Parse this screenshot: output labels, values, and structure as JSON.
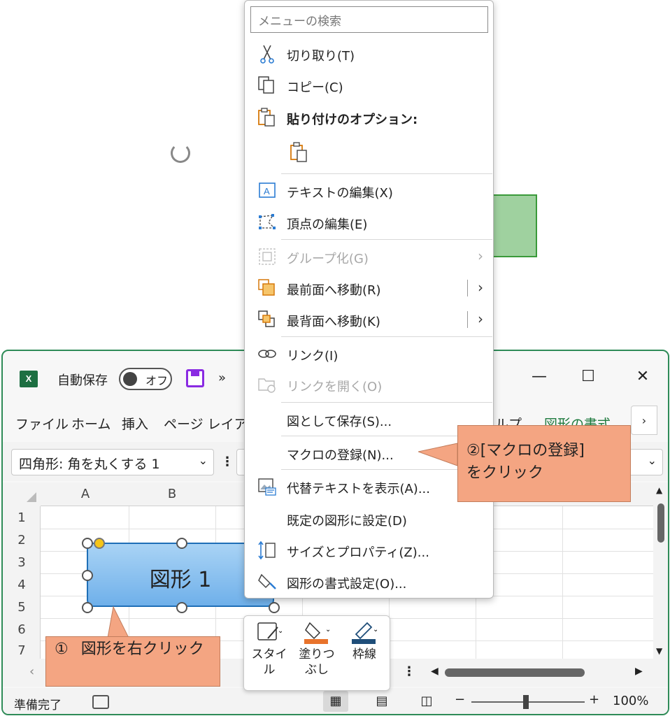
{
  "titlebar": {
    "app_icon": "X",
    "autosave_label": "自動保存",
    "toggle_label": "オフ",
    "overflow": "»",
    "minimize": "—",
    "maximize": "☐",
    "close": "✕"
  },
  "ribbon_tabs": [
    {
      "label": "ファイル"
    },
    {
      "label": "ホーム"
    },
    {
      "label": "挿入"
    },
    {
      "label": "ページ レイア"
    },
    {
      "label": "ルプ"
    },
    {
      "label": "図形の書式"
    }
  ],
  "ribbon_chevron": "›",
  "namebox": {
    "value": "四角形: 角を丸くする 1"
  },
  "columns": [
    "A",
    "B"
  ],
  "rows": [
    "1",
    "2",
    "3",
    "4",
    "5",
    "6",
    "7"
  ],
  "shape1": {
    "text": "図形 1",
    "fill": "#8cc3f0",
    "border": "#1f6fb7"
  },
  "shape2": {
    "fill": "#9fd19f",
    "border": "#3a9a3a"
  },
  "sheetbar": {
    "dots": "⋮"
  },
  "statusbar": {
    "text": "準備完了",
    "zoom_minus": "−",
    "zoom_plus": "+",
    "zoom": "100%"
  },
  "minibar": {
    "style": "スタイル",
    "fill": "塗りつぶし",
    "fill_color": "#e8732c",
    "outline": "枠線",
    "outline_color": "#1f4e79"
  },
  "context_menu": {
    "search_placeholder": "メニューの検索",
    "cut": "切り取り(T)",
    "copy": "コピー(C)",
    "paste_options": "貼り付けのオプション:",
    "edit_text": "テキストの編集(X)",
    "edit_points": "頂点の編集(E)",
    "group": "グループ化(G)",
    "bring_front": "最前面へ移動(R)",
    "send_back": "最背面へ移動(K)",
    "link": "リンク(I)",
    "open_link": "リンクを開く(O)",
    "save_as_picture": "図として保存(S)...",
    "assign_macro": "マクロの登録(N)...",
    "alt_text": "代替テキストを表示(A)...",
    "set_default": "既定の図形に設定(D)",
    "size_props": "サイズとプロパティ(Z)...",
    "format_shape": "図形の書式設定(O)..."
  },
  "callouts": {
    "step1_num": "①",
    "step1": "図形を右クリック",
    "step2_line1": "②[マクロの登録]",
    "step2_line2": "をクリック",
    "color": "#f4a582"
  }
}
